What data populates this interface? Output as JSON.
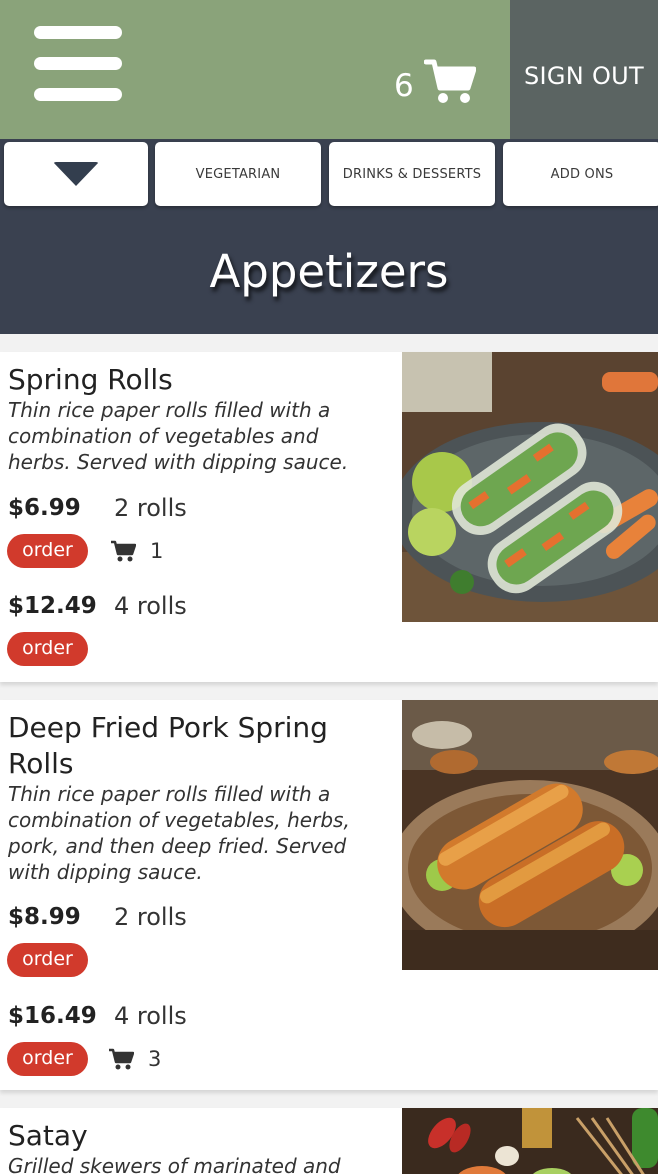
{
  "header": {
    "cart_count": "6",
    "sign_out_label": "SIGN OUT",
    "colors": {
      "topbar": "#8aa37a",
      "signout": "#5b6462"
    }
  },
  "tabs": {
    "items": [
      {
        "label": "VEGETARIAN"
      },
      {
        "label": "DRINKS & DESSERTS"
      },
      {
        "label": "ADD ONS"
      }
    ]
  },
  "section": {
    "title": "Appetizers"
  },
  "icons": {
    "menu": "hamburger-icon",
    "cart": "cart-icon",
    "dropdown": "triangle-down-icon"
  },
  "items": [
    {
      "name": "Spring Rolls",
      "description": "Thin rice paper rolls filled with a combination of vegetables and herbs. Served with dipping sauce.",
      "options": [
        {
          "price": "$6.99",
          "qty": "2 rolls",
          "order_label": "order",
          "in_cart": "1"
        },
        {
          "price": "$12.49",
          "qty": "4 rolls",
          "order_label": "order"
        }
      ]
    },
    {
      "name": "Deep Fried Pork Spring Rolls",
      "description": "Thin rice paper rolls filled with a combination of vegetables, herbs, pork, and then deep fried. Served with dipping sauce.",
      "options": [
        {
          "price": "$8.99",
          "qty": "2 rolls",
          "order_label": "order"
        },
        {
          "price": "$16.49",
          "qty": "4 rolls",
          "order_label": "order",
          "in_cart": "3"
        }
      ]
    },
    {
      "name": "Satay",
      "description": "Grilled skewers of marinated and"
    }
  ],
  "accent_color": "#d13a2c"
}
